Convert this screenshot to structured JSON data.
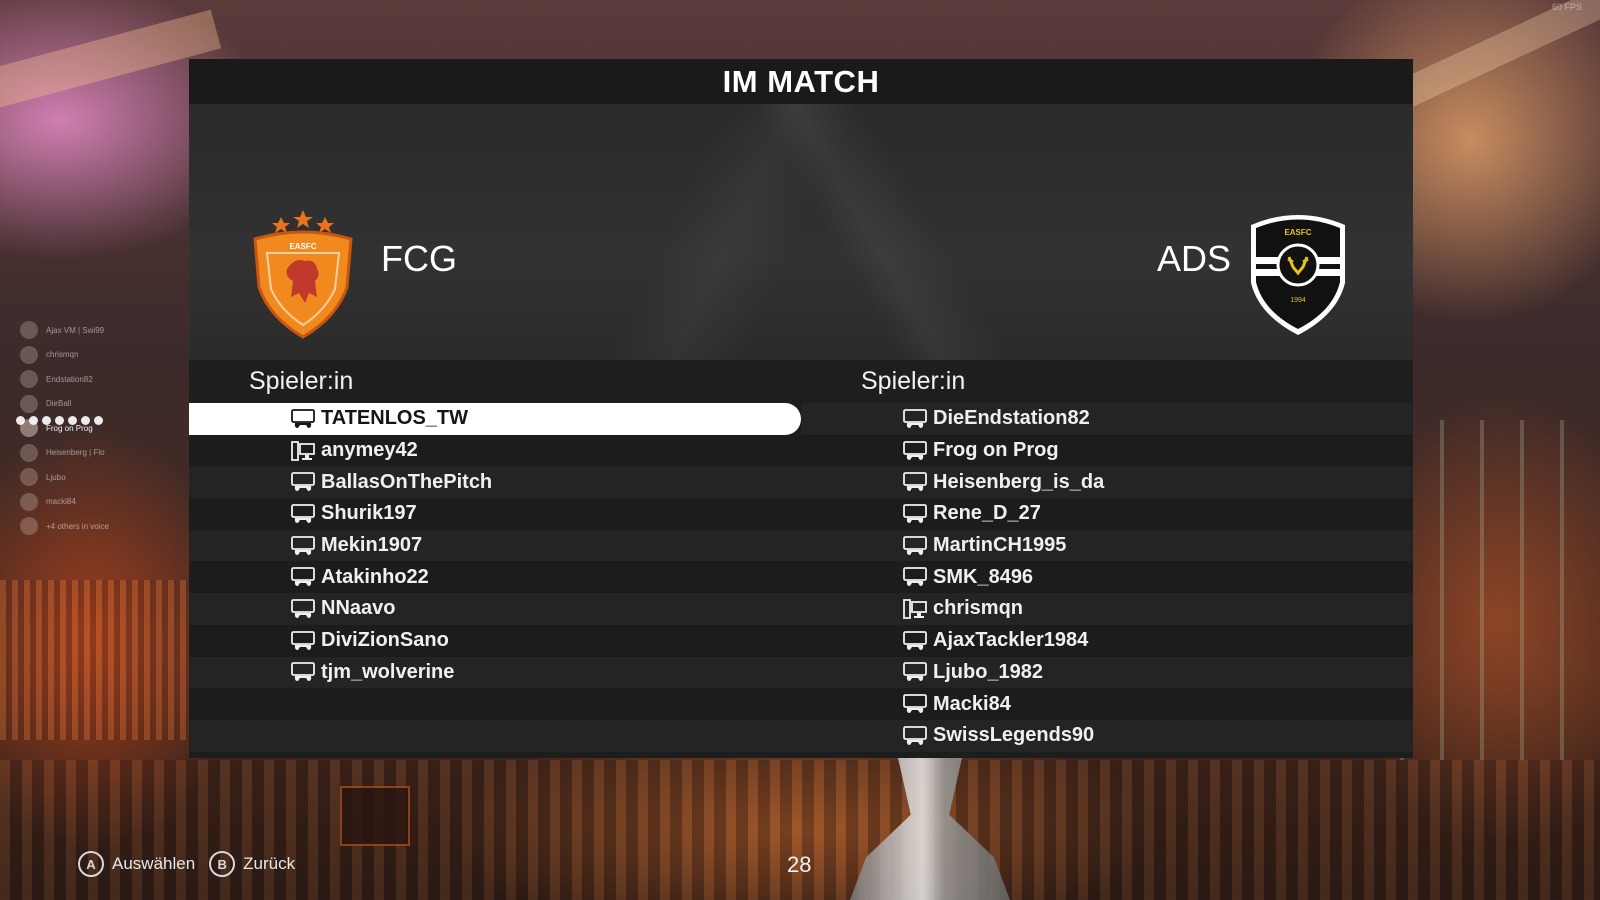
{
  "overlay": {
    "fps": "60 FPS",
    "presence": [
      {
        "name": "Ajax VM | Swi99",
        "active": false
      },
      {
        "name": "chrismqn",
        "active": false
      },
      {
        "name": "Endstation82",
        "active": false
      },
      {
        "name": "DieBall",
        "active": false
      },
      {
        "name": "Frog on Prog",
        "active": true
      },
      {
        "name": "Heisenberg | Flo",
        "active": false
      },
      {
        "name": "Ljubo",
        "active": false
      },
      {
        "name": "macki84",
        "active": false
      },
      {
        "name": "+4 others in voice",
        "active": false
      }
    ]
  },
  "panel": {
    "title": "IM MATCH",
    "home": {
      "name": "FCG",
      "crest_color": "#e8731c",
      "crest_text": "EASFC"
    },
    "away": {
      "name": "ADS",
      "crest_color": "#111111",
      "crest_text": "EASFC",
      "crest_year": "1994"
    },
    "column_header": "Spieler:in",
    "home_players": [
      {
        "name": "TATENLOS_TW",
        "platform": "console-icon",
        "selected": true
      },
      {
        "name": "anymey42",
        "platform": "pc-icon"
      },
      {
        "name": "BallasOnThePitch",
        "platform": "console-icon"
      },
      {
        "name": "Shurik197",
        "platform": "console-icon"
      },
      {
        "name": "Mekin1907",
        "platform": "console-icon"
      },
      {
        "name": "Atakinho22",
        "platform": "console-icon"
      },
      {
        "name": "NNaavo",
        "platform": "console-icon"
      },
      {
        "name": "DiviZionSano",
        "platform": "console-icon"
      },
      {
        "name": "tjm_wolverine",
        "platform": "console-icon"
      }
    ],
    "away_players": [
      {
        "name": "DieEndstation82",
        "platform": "console-icon"
      },
      {
        "name": "Frog on Prog",
        "platform": "console-icon"
      },
      {
        "name": "Heisenberg_is_da",
        "platform": "console-icon"
      },
      {
        "name": "Rene_D_27",
        "platform": "console-icon"
      },
      {
        "name": "MartinCH1995",
        "platform": "console-icon"
      },
      {
        "name": "SMK_8496",
        "platform": "console-icon"
      },
      {
        "name": "chrismqn",
        "platform": "pc-icon"
      },
      {
        "name": "AjaxTackler1984",
        "platform": "console-icon"
      },
      {
        "name": "Ljubo_1982",
        "platform": "console-icon"
      },
      {
        "name": "Macki84",
        "platform": "console-icon"
      },
      {
        "name": "SwissLegends90",
        "platform": "console-icon"
      }
    ]
  },
  "footer": {
    "select_button": "A",
    "select_label": "Auswählen",
    "back_button": "B",
    "back_label": "Zurück",
    "timer": "28"
  }
}
